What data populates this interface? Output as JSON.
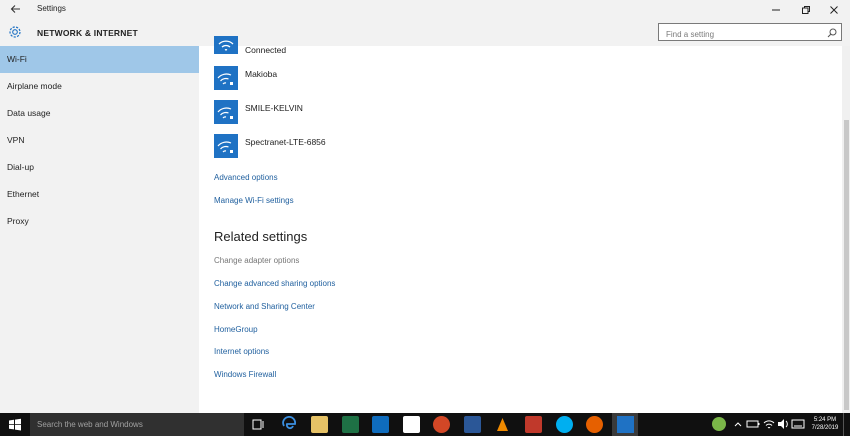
{
  "window": {
    "title": "Settings",
    "back_icon": "back-arrow-icon",
    "controls": [
      "minimize",
      "restore",
      "close"
    ]
  },
  "header": {
    "section": "NETWORK & INTERNET",
    "icon": "gear-icon",
    "search_placeholder": "Find a setting"
  },
  "sidebar": {
    "items": [
      {
        "label": "Wi-Fi",
        "active": true
      },
      {
        "label": "Airplane mode",
        "active": false
      },
      {
        "label": "Data usage",
        "active": false
      },
      {
        "label": "VPN",
        "active": false
      },
      {
        "label": "Dial-up",
        "active": false
      },
      {
        "label": "Ethernet",
        "active": false
      },
      {
        "label": "Proxy",
        "active": false
      }
    ]
  },
  "main": {
    "connected_status": "Connected",
    "networks": [
      {
        "name": "Makioba",
        "icon": "wifi-secured-icon"
      },
      {
        "name": "SMILE-KELVIN",
        "icon": "wifi-secured-icon"
      },
      {
        "name": "Spectranet-LTE-6856",
        "icon": "wifi-secured-icon"
      }
    ],
    "links": [
      "Advanced options",
      "Manage Wi-Fi settings"
    ],
    "related": {
      "title": "Related settings",
      "items": [
        "Change adapter options",
        "Change advanced sharing options",
        "Network and Sharing Center",
        "HomeGroup",
        "Internet options",
        "Windows Firewall"
      ]
    }
  },
  "taskbar": {
    "search_placeholder": "Search the web and Windows",
    "clock_time": "5:24 PM",
    "clock_date": "7/28/2019",
    "accent": "#1f72c4"
  }
}
